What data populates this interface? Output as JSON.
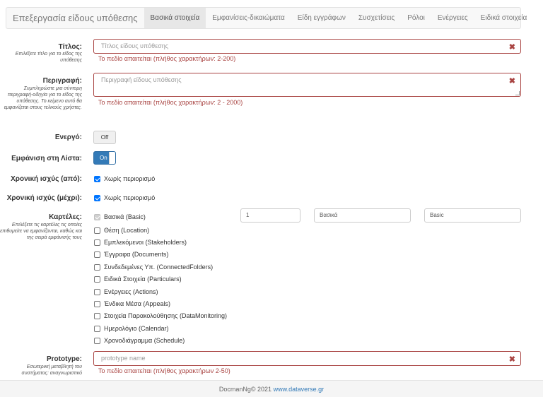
{
  "header": {
    "brand": "Επεξεργασία είδους υπόθεσης",
    "tabs": [
      {
        "label": "Βασικά στοιχεία",
        "active": true
      },
      {
        "label": "Εμφανίσεις-δικαιώματα"
      },
      {
        "label": "Είδη εγγράφων"
      },
      {
        "label": "Συσχετίσεις"
      },
      {
        "label": "Ρόλοι"
      },
      {
        "label": "Ενέργειες"
      },
      {
        "label": "Ειδικά στοιχεία"
      }
    ]
  },
  "form": {
    "title": {
      "label": "Τίτλος:",
      "help": "Επιλέξετε τίτλο για το είδος της υπόθεσης",
      "placeholder": "Τίτλος είδους υπόθεσης",
      "error": "Το πεδίο απαιτείται (πλήθος χαρακτήρων: 2-200)"
    },
    "description": {
      "label": "Περιγραφή:",
      "help": "Συμπληρώστε μια σύντομη περιγραφή-οδηγία για το είδος της υπόθεσης. Το κείμενο αυτό θα εμφανίζεται στους τελικούς χρήστες.",
      "placeholder": "Περιγραφή είδους υπόθεσης",
      "error": "Το πεδίο απαιτείται (πλήθος χαρακτήρων: 2 - 2000)"
    },
    "active": {
      "label": "Ενεργό:",
      "state": "Off"
    },
    "show_in_list": {
      "label": "Εμφάνιση στη Λίστα:",
      "state": "On"
    },
    "valid_from": {
      "label": "Χρονική ισχύς (από):",
      "checkbox": "Χωρίς περιορισμό"
    },
    "valid_to": {
      "label": "Χρονική ισχύς (μέχρι):",
      "checkbox": "Χωρίς περιορισμό"
    },
    "tabs_field": {
      "label": "Καρτέλες:",
      "help": "Επιλέξετε τις καρτέλες τις οποίες επιθυμείτε να εμφανίζονται, καθώς και της σειρά εμφάνισής τους",
      "items": [
        "Βασικά (Basic)",
        "Θέση (Location)",
        "Εμπλεκόμενοι (Stakeholders)",
        "Έγγραφα (Documents)",
        "Συνδεδεμένες Υπ. (ConnectedFolders)",
        "Ειδικά Στοιχεία (Particulars)",
        "Ενέργειες (Actions)",
        "Ένδικα Μέσα (Appeals)",
        "Στοιχεία Παρακολούθησης (DataMonitoring)",
        "Ημερολόγιο (Calendar)",
        "Χρονοδιάγραμμα (Schedule)"
      ],
      "basic_order": "1",
      "basic_label_el": "Βασικά",
      "basic_label_en": "Basic"
    },
    "prototype": {
      "label": "Prototype:",
      "help": "Εσωτερική μεταβλητή του συστήματος: αναγνωριστικό",
      "placeholder": "prototype name",
      "error": "Το πεδίο απαιτείται (πλήθος χαρακτήρων 2-50)"
    }
  },
  "footer": {
    "text": "DocmanNg© 2021",
    "link": "www.dataverse.gr"
  }
}
